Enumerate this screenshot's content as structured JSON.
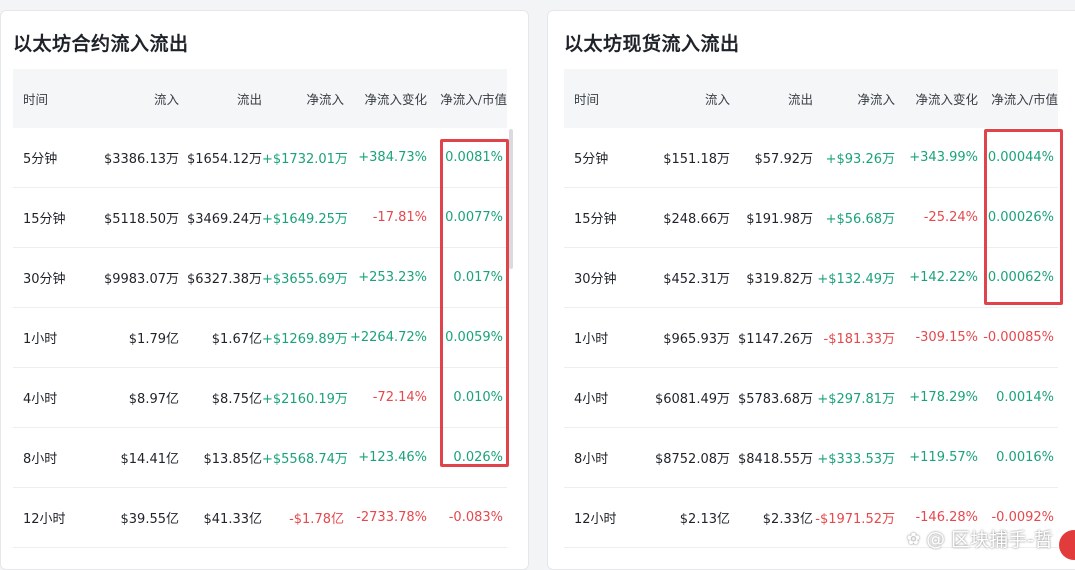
{
  "left_panel": {
    "title": "以太坊合约流入流出",
    "headers": [
      "时间",
      "流入",
      "流出",
      "净流入",
      "净流入变化",
      "净流入/市值"
    ],
    "rows": [
      {
        "time": "5分钟",
        "inflow": "$3386.13万",
        "outflow": "$1654.12万",
        "net": "+$1732.01万",
        "change": "+384.73%",
        "ratio": "0.0081%"
      },
      {
        "time": "15分钟",
        "inflow": "$5118.50万",
        "outflow": "$3469.24万",
        "net": "+$1649.25万",
        "change": "-17.81%",
        "ratio": "0.0077%"
      },
      {
        "time": "30分钟",
        "inflow": "$9983.07万",
        "outflow": "$6327.38万",
        "net": "+$3655.69万",
        "change": "+253.23%",
        "ratio": "0.017%"
      },
      {
        "time": "1小时",
        "inflow": "$1.79亿",
        "outflow": "$1.67亿",
        "net": "+$1269.89万",
        "change": "+2264.72%",
        "ratio": "0.0059%"
      },
      {
        "time": "4小时",
        "inflow": "$8.97亿",
        "outflow": "$8.75亿",
        "net": "+$2160.19万",
        "change": "-72.14%",
        "ratio": "0.010%"
      },
      {
        "time": "8小时",
        "inflow": "$14.41亿",
        "outflow": "$13.85亿",
        "net": "+$5568.74万",
        "change": "+123.46%",
        "ratio": "0.026%"
      },
      {
        "time": "12小时",
        "inflow": "$39.55亿",
        "outflow": "$41.33亿",
        "net": "-$1.78亿",
        "change": "-2733.78%",
        "ratio": "-0.083%"
      }
    ]
  },
  "right_panel": {
    "title": "以太坊现货流入流出",
    "headers": [
      "时间",
      "流入",
      "流出",
      "净流入",
      "净流入变化",
      "净流入/市值"
    ],
    "rows": [
      {
        "time": "5分钟",
        "inflow": "$151.18万",
        "outflow": "$57.92万",
        "net": "+$93.26万",
        "change": "+343.99%",
        "ratio": "0.00044%"
      },
      {
        "time": "15分钟",
        "inflow": "$248.66万",
        "outflow": "$191.98万",
        "net": "+$56.68万",
        "change": "-25.24%",
        "ratio": "0.00026%"
      },
      {
        "time": "30分钟",
        "inflow": "$452.31万",
        "outflow": "$319.82万",
        "net": "+$132.49万",
        "change": "+142.22%",
        "ratio": "0.00062%"
      },
      {
        "time": "1小时",
        "inflow": "$965.93万",
        "outflow": "$1147.26万",
        "net": "-$181.33万",
        "change": "-309.15%",
        "ratio": "-0.00085%"
      },
      {
        "time": "4小时",
        "inflow": "$6081.49万",
        "outflow": "$5783.68万",
        "net": "+$297.81万",
        "change": "+178.29%",
        "ratio": "0.0014%"
      },
      {
        "time": "8小时",
        "inflow": "$8752.08万",
        "outflow": "$8418.55万",
        "net": "+$333.53万",
        "change": "+119.57%",
        "ratio": "0.0016%"
      },
      {
        "time": "12小时",
        "inflow": "$2.13亿",
        "outflow": "$2.33亿",
        "net": "-$1971.52万",
        "change": "-146.28%",
        "ratio": "-0.0092%"
      }
    ]
  },
  "watermark": {
    "text": "区块捕手-哲",
    "icon": "wechat-icon"
  },
  "colors": {
    "positive": "#1aa37a",
    "negative": "#e5484d",
    "highlight": "#e0444a",
    "header_bg": "#f5f6f8"
  }
}
